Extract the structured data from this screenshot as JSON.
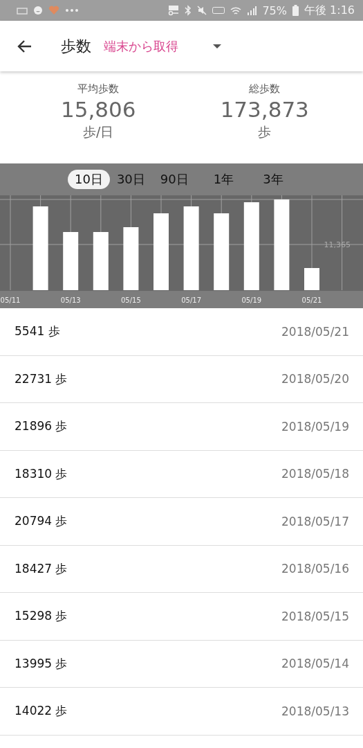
{
  "status_bar": {
    "battery": "75%",
    "time": "午後 1:16"
  },
  "header": {
    "title": "歩数",
    "source": "端末から取得"
  },
  "stats": [
    {
      "label": "平均歩数",
      "value": "15,806",
      "unit": "歩/日"
    },
    {
      "label": "総歩数",
      "value": "173,873",
      "unit": "歩"
    }
  ],
  "range_tabs": [
    {
      "label": "10日",
      "selected": true
    },
    {
      "label": "30日",
      "selected": false
    },
    {
      "label": "90日",
      "selected": false
    },
    {
      "label": "1年",
      "selected": false
    },
    {
      "label": "3年",
      "selected": false
    }
  ],
  "chart": {
    "x_labels": [
      "05/11",
      "05/13",
      "05/15",
      "05/17",
      "05/19",
      "05/21"
    ],
    "y_label": "11,365"
  },
  "rows": [
    {
      "steps": "5541 歩",
      "date": "2018/05/21"
    },
    {
      "steps": "22731 歩",
      "date": "2018/05/20"
    },
    {
      "steps": "21896 歩",
      "date": "2018/05/19"
    },
    {
      "steps": "18310 歩",
      "date": "2018/05/18"
    },
    {
      "steps": "20794 歩",
      "date": "2018/05/17"
    },
    {
      "steps": "18427 歩",
      "date": "2018/05/16"
    },
    {
      "steps": "15298 歩",
      "date": "2018/05/15"
    },
    {
      "steps": "13995 歩",
      "date": "2018/05/14"
    },
    {
      "steps": "14022 歩",
      "date": "2018/05/13"
    }
  ]
}
